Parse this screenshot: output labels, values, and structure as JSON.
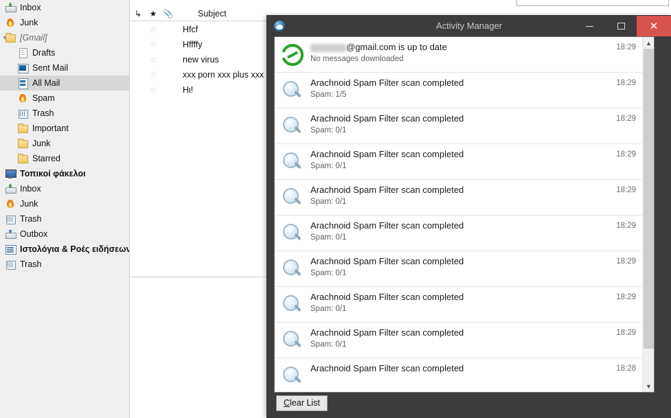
{
  "sidebar": {
    "items": [
      {
        "label": "Inbox",
        "icon": "inbox-icon",
        "indent": 0,
        "bold": false,
        "italic": false,
        "selected": false,
        "twisty": "none"
      },
      {
        "label": "Junk",
        "icon": "junk-icon",
        "indent": 0,
        "bold": false,
        "italic": false,
        "selected": false,
        "twisty": "none"
      },
      {
        "label": "[Gmail]",
        "icon": "folder-icon",
        "indent": 0,
        "bold": false,
        "italic": true,
        "selected": false,
        "twisty": "open"
      },
      {
        "label": "Drafts",
        "icon": "draft-icon",
        "indent": 1,
        "bold": false,
        "italic": false,
        "selected": false,
        "twisty": "none"
      },
      {
        "label": "Sent Mail",
        "icon": "sent-icon",
        "indent": 1,
        "bold": false,
        "italic": false,
        "selected": false,
        "twisty": "none"
      },
      {
        "label": "All Mail",
        "icon": "allmail-icon",
        "indent": 1,
        "bold": false,
        "italic": false,
        "selected": true,
        "twisty": "none"
      },
      {
        "label": "Spam",
        "icon": "junk-icon",
        "indent": 1,
        "bold": false,
        "italic": false,
        "selected": false,
        "twisty": "none"
      },
      {
        "label": "Trash",
        "icon": "trash-icon",
        "indent": 1,
        "bold": false,
        "italic": false,
        "selected": false,
        "twisty": "none"
      },
      {
        "label": "Important",
        "icon": "folder-icon",
        "indent": 1,
        "bold": false,
        "italic": false,
        "selected": false,
        "twisty": "none"
      },
      {
        "label": "Junk",
        "icon": "folder-icon",
        "indent": 1,
        "bold": false,
        "italic": false,
        "selected": false,
        "twisty": "none"
      },
      {
        "label": "Starred",
        "icon": "folder-icon",
        "indent": 1,
        "bold": false,
        "italic": false,
        "selected": false,
        "twisty": "none"
      },
      {
        "label": "Τοπικοί φάκελοι",
        "icon": "monitor-icon",
        "indent": 0,
        "bold": true,
        "italic": false,
        "selected": false,
        "twisty": "none"
      },
      {
        "label": "Inbox",
        "icon": "inbox-icon",
        "indent": 0,
        "bold": false,
        "italic": false,
        "selected": false,
        "twisty": "none"
      },
      {
        "label": "Junk",
        "icon": "junk-icon",
        "indent": 0,
        "bold": false,
        "italic": false,
        "selected": false,
        "twisty": "none"
      },
      {
        "label": "Trash",
        "icon": "trash-icon",
        "indent": 0,
        "bold": false,
        "italic": false,
        "selected": false,
        "twisty": "none"
      },
      {
        "label": "Outbox",
        "icon": "outbox-icon",
        "indent": 0,
        "bold": false,
        "italic": false,
        "selected": false,
        "twisty": "none"
      },
      {
        "label": "Ιστολόγια & Ροές ειδήσεων",
        "icon": "feed-icon",
        "indent": 0,
        "bold": true,
        "italic": false,
        "selected": false,
        "twisty": "none"
      },
      {
        "label": "Trash",
        "icon": "trash-icon",
        "indent": 0,
        "bold": false,
        "italic": false,
        "selected": false,
        "twisty": "none"
      }
    ]
  },
  "threadpane": {
    "search": {
      "value": "",
      "placeholder": ""
    },
    "columns": {
      "thread_icon": "↳",
      "star_icon": "★",
      "attachment_icon": "📎",
      "subject": "Subject"
    },
    "rows": [
      {
        "star": "☆",
        "subject": "Hfcf"
      },
      {
        "star": "☆",
        "subject": "Hffffy"
      },
      {
        "star": "☆",
        "subject": "new virus"
      },
      {
        "star": "☆",
        "subject": "xxx porn xxx plus xxx"
      },
      {
        "star": "☆",
        "subject": "Hι!"
      }
    ]
  },
  "activity_manager": {
    "title": "Activity Manager",
    "window_icon": "thunderbird-icon",
    "buttons": {
      "minimize": "minimize-icon",
      "maximize": "maximize-icon",
      "close": "✕"
    },
    "accent_close": "#d9534f",
    "accent_sync": "#22a526",
    "rows": [
      {
        "icon": "sync-icon",
        "title": "@gmail.com is up to date",
        "subtitle": "No messages downloaded",
        "time": "18:29"
      },
      {
        "icon": "magnify-icon",
        "title": "Arachnoid Spam Filter scan completed",
        "subtitle": "Spam: 1/5",
        "time": "18:29"
      },
      {
        "icon": "magnify-icon",
        "title": "Arachnoid Spam Filter scan completed",
        "subtitle": "Spam: 0/1",
        "time": "18:29"
      },
      {
        "icon": "magnify-icon",
        "title": "Arachnoid Spam Filter scan completed",
        "subtitle": "Spam: 0/1",
        "time": "18:29"
      },
      {
        "icon": "magnify-icon",
        "title": "Arachnoid Spam Filter scan completed",
        "subtitle": "Spam: 0/1",
        "time": "18:29"
      },
      {
        "icon": "magnify-icon",
        "title": "Arachnoid Spam Filter scan completed",
        "subtitle": "Spam: 0/1",
        "time": "18:29"
      },
      {
        "icon": "magnify-icon",
        "title": "Arachnoid Spam Filter scan completed",
        "subtitle": "Spam: 0/1",
        "time": "18:29"
      },
      {
        "icon": "magnify-icon",
        "title": "Arachnoid Spam Filter scan completed",
        "subtitle": "Spam: 0/1",
        "time": "18:29"
      },
      {
        "icon": "magnify-icon",
        "title": "Arachnoid Spam Filter scan completed",
        "subtitle": "Spam: 0/1",
        "time": "18:29"
      },
      {
        "icon": "magnify-icon",
        "title": "Arachnoid Spam Filter scan completed",
        "subtitle": "",
        "time": "18:28"
      }
    ],
    "scrollbar": {
      "up_icon": "▲",
      "down_icon": "▼"
    },
    "footer": {
      "clear_accel": "C",
      "clear_rest": "lear List"
    }
  }
}
